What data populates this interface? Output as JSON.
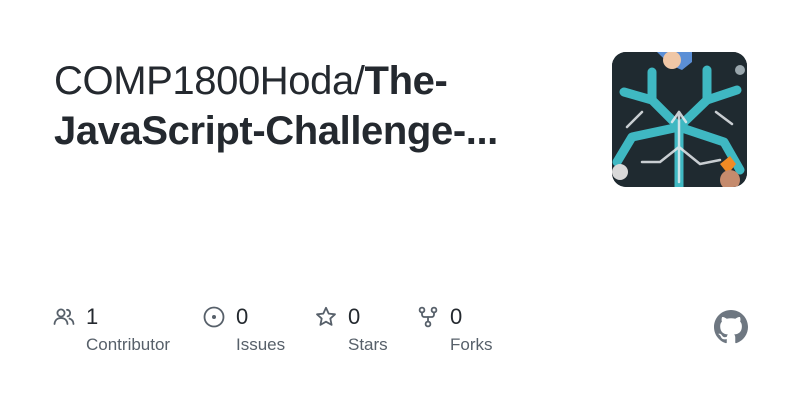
{
  "repo": {
    "owner": "COMP1800Hoda/",
    "name_line1": "The-",
    "name_line2": "JavaScript-Challenge-..."
  },
  "avatar": {
    "icon": "repo-social-image",
    "description_colors": [
      "#1e272c",
      "#3fb8c2"
    ]
  },
  "stats": [
    {
      "icon": "people-icon",
      "count": "1",
      "label": "Contributor"
    },
    {
      "icon": "issue-opened-icon",
      "count": "0",
      "label": "Issues"
    },
    {
      "icon": "star-icon",
      "count": "0",
      "label": "Stars"
    },
    {
      "icon": "repo-forked-icon",
      "count": "0",
      "label": "Forks"
    }
  ],
  "brand": {
    "icon": "github-mark-icon",
    "text_color": "#24292f",
    "muted_color": "#57606a",
    "icon_color": "#6e7781"
  }
}
